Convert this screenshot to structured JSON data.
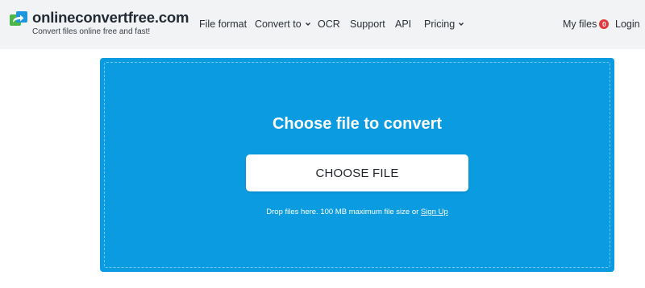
{
  "header": {
    "logo": {
      "icon": "arrows-swap-icon",
      "title": "onlineconvertfree.com",
      "subtitle": "Convert files online free and fast!"
    },
    "nav": [
      {
        "label": "File format",
        "dropdown": false
      },
      {
        "label": "Convert to",
        "dropdown": true
      },
      {
        "label": "OCR",
        "dropdown": false
      },
      {
        "label": "Support",
        "dropdown": false
      },
      {
        "label": "API",
        "dropdown": false
      },
      {
        "label": "Pricing",
        "dropdown": true
      }
    ],
    "my_files": {
      "label": "My files",
      "count": "0"
    },
    "login": "Login"
  },
  "upload": {
    "title": "Choose file to convert",
    "button": "CHOOSE FILE",
    "drop_text": "Drop files here. 100 MB maximum file size or",
    "signup_link": "Sign Up"
  },
  "colors": {
    "header_bg": "#f2f3f5",
    "upload_bg": "#0a9be0",
    "badge": "#e23a3a",
    "logo_green": "#4cb648",
    "logo_blue": "#1e96de"
  }
}
